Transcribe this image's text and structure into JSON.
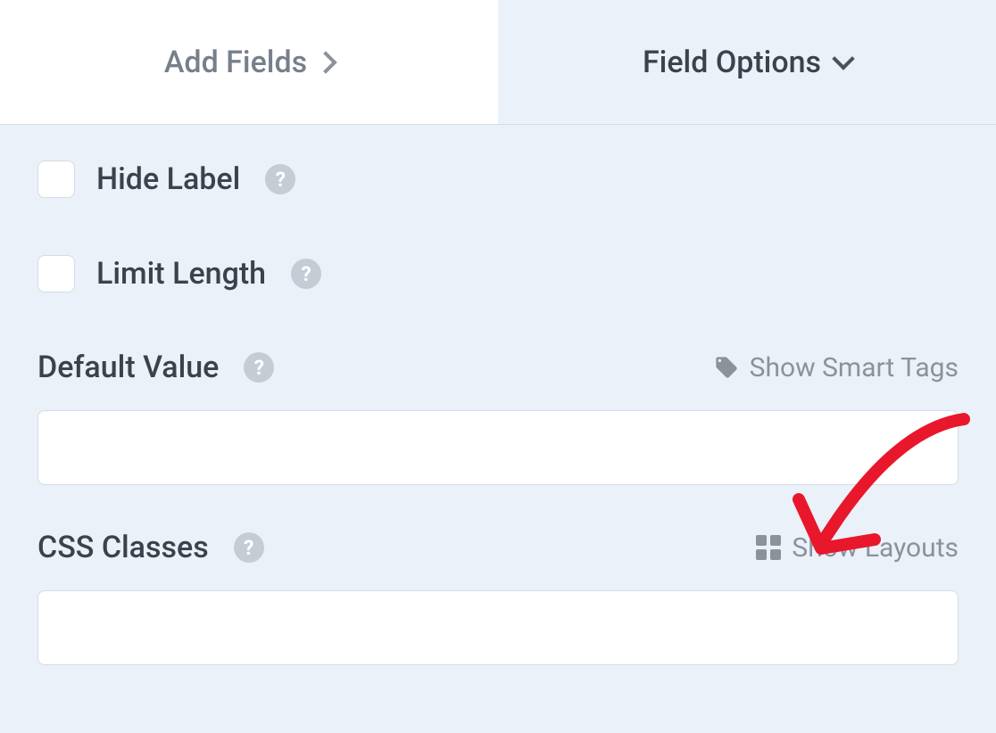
{
  "tabs": {
    "addFields": "Add Fields",
    "fieldOptions": "Field Options"
  },
  "checkboxes": {
    "hideLabel": "Hide Label",
    "limitLength": "Limit Length"
  },
  "defaultValue": {
    "label": "Default Value",
    "smartTagsLink": "Show Smart Tags",
    "value": ""
  },
  "cssClasses": {
    "label": "CSS Classes",
    "layoutsLink": "Show Layouts",
    "value": ""
  }
}
